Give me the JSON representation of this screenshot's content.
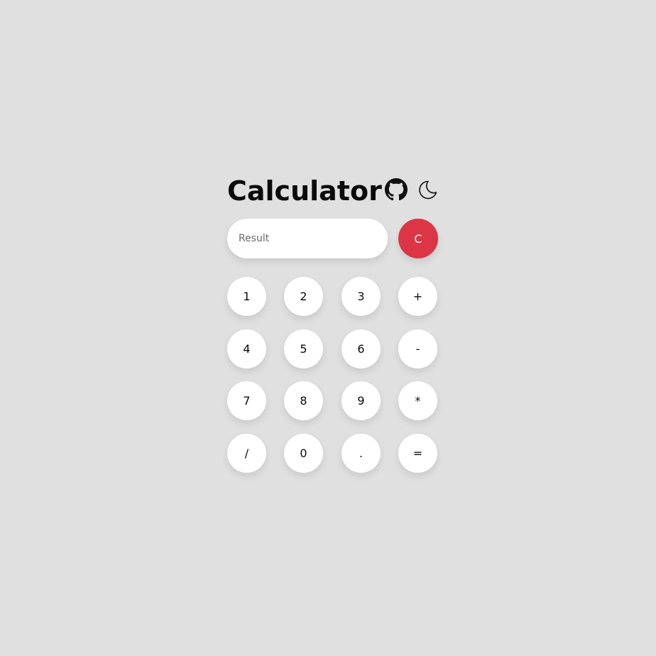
{
  "header": {
    "title": "Calculator",
    "github_icon": "github-icon",
    "theme_icon": "moon-icon"
  },
  "display": {
    "placeholder": "Result",
    "value": "",
    "clear_label": "C",
    "clear_color": "#dc3545"
  },
  "keys": {
    "row1": [
      "1",
      "2",
      "3",
      "+"
    ],
    "row2": [
      "4",
      "5",
      "6",
      "-"
    ],
    "row3": [
      "7",
      "8",
      "9",
      "*"
    ],
    "row4": [
      "/",
      "0",
      ".",
      "="
    ]
  },
  "colors": {
    "background": "#e0e0e0",
    "button": "#ffffff",
    "text": "#0a0a0a"
  }
}
